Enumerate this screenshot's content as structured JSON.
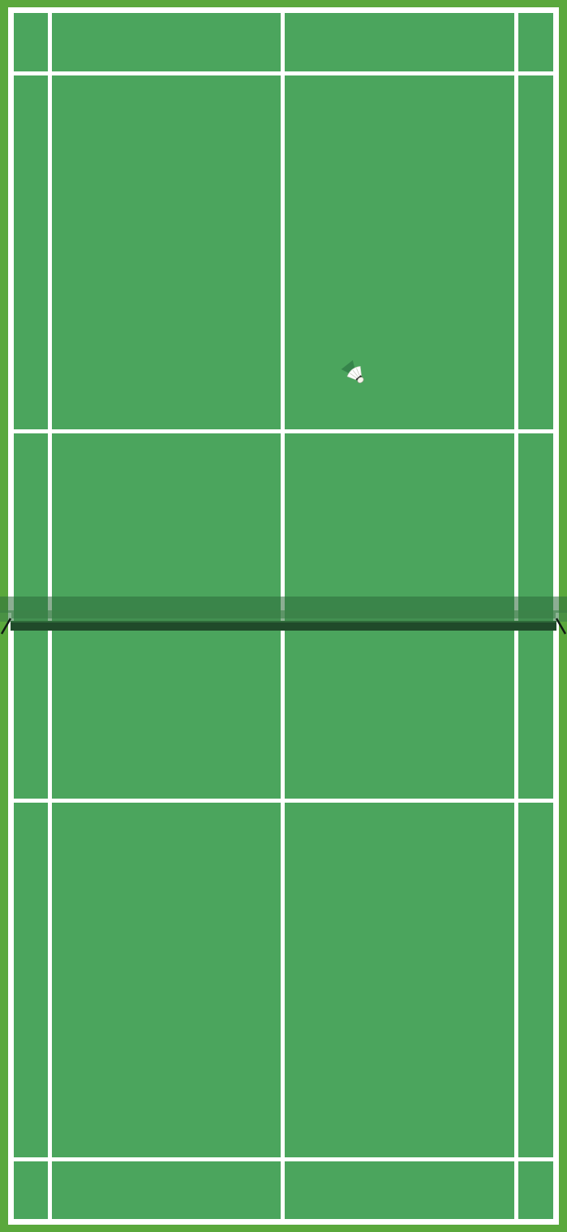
{
  "game": {
    "type": "badminton",
    "view": "top-down",
    "court": {
      "surround_color": "#5aa83c",
      "surface_color": "#4ba55d",
      "line_color": "#ffffff"
    },
    "net": {
      "color": "#204a2a",
      "shadow_color": "#2e6b3b"
    },
    "shuttlecock": {
      "icon": "shuttlecock-icon",
      "feather_color": "#ffffff",
      "cork_color": "#f4f4ea",
      "shadow_color": "#2f7a45"
    }
  }
}
